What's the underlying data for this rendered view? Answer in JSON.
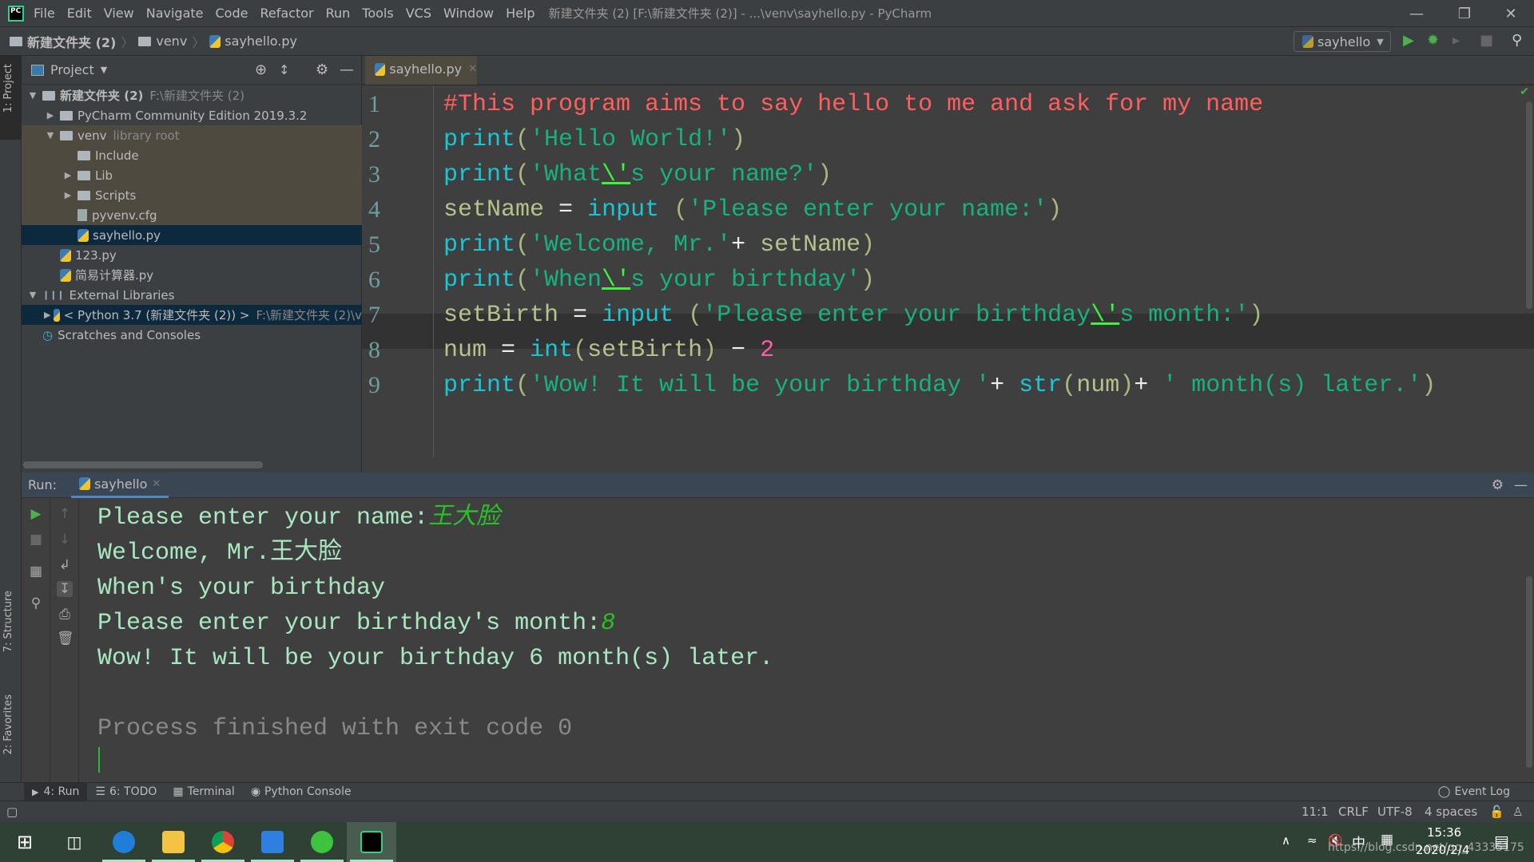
{
  "window": {
    "title": "新建文件夹 (2) [F:\\新建文件夹 (2)] - ...\\venv\\sayhello.py - PyCharm",
    "menu": [
      "File",
      "Edit",
      "View",
      "Navigate",
      "Code",
      "Refactor",
      "Run",
      "Tools",
      "VCS",
      "Window",
      "Help"
    ]
  },
  "breadcrumb": [
    "新建文件夹 (2)",
    "venv",
    "sayhello.py"
  ],
  "toolbar": {
    "run_config": "sayhello"
  },
  "side_tabs": {
    "project": "1: Project",
    "structure": "7: Structure",
    "favorites": "2: Favorites"
  },
  "project": {
    "title": "Project",
    "tree": [
      {
        "label": "新建文件夹 (2)",
        "hint": "F:\\新建文件夹 (2)",
        "icon": "folder-icon",
        "expanded": true,
        "level": 0
      },
      {
        "label": "PyCharm Community Edition 2019.3.2",
        "icon": "folder-icon",
        "expanded": false,
        "level": 1
      },
      {
        "label": "venv",
        "hint": "library root",
        "icon": "folder-icon",
        "expanded": true,
        "level": 1
      },
      {
        "label": "Include",
        "icon": "folder-icon",
        "level": 2
      },
      {
        "label": "Lib",
        "icon": "folder-icon",
        "expanded": false,
        "level": 2
      },
      {
        "label": "Scripts",
        "icon": "folder-icon",
        "expanded": false,
        "level": 2
      },
      {
        "label": "pyvenv.cfg",
        "icon": "file-icon",
        "level": 2
      },
      {
        "label": "sayhello.py",
        "icon": "python-file-icon",
        "level": 2,
        "selected": true
      },
      {
        "label": "123.py",
        "icon": "python-file-icon",
        "level": 1
      },
      {
        "label": "简易计算器.py",
        "icon": "python-file-icon",
        "level": 1
      },
      {
        "label": "External Libraries",
        "icon": "library-icon",
        "expanded": true,
        "level": 0
      },
      {
        "label": "< Python 3.7 (新建文件夹 (2)) >",
        "hint": "F:\\新建文件夹 (2)\\v",
        "icon": "python-icon",
        "expanded": false,
        "level": 1
      },
      {
        "label": "Scratches and Consoles",
        "icon": "scratches-icon",
        "level": 0
      }
    ]
  },
  "editor": {
    "tab": "sayhello.py",
    "current_line": 8,
    "lines": [
      "#This program aims to say hello to me and ask for my name",
      "print('Hello World!')",
      "print('What\\'s your name?')",
      "setName = input ('Please enter your name:')",
      "print('Welcome, Mr.'+ setName)",
      "print('When\\'s your birthday')",
      "setBirth = input ('Please enter your birthday\\'s month:')",
      "num = int(setBirth) - 2",
      "print('Wow! It will be your birthday '+ str(num)+ ' month(s) later.')"
    ]
  },
  "run": {
    "label": "Run:",
    "tab": "sayhello",
    "output": [
      {
        "text": "Please enter your name:",
        "input": "王大脸"
      },
      {
        "text": "Welcome, Mr.王大脸"
      },
      {
        "text": "When's your birthday"
      },
      {
        "text": "Please enter your birthday's month:",
        "input": "8"
      },
      {
        "text": "Wow! It will be your birthday 6 month(s) later."
      },
      {
        "text": ""
      },
      {
        "text": "Process finished with exit code 0"
      }
    ]
  },
  "bottom_tabs": [
    "4: Run",
    "6: TODO",
    "Terminal",
    "Python Console"
  ],
  "event_log": "Event Log",
  "status": {
    "position": "11:1",
    "line_sep": "CRLF",
    "encoding": "UTF-8",
    "indent": "4 spaces"
  },
  "taskbar": {
    "time": "15:36",
    "date": "2020/2/4",
    "ime": "中",
    "watermark": "https://blog.csdn.net/qq_43335175"
  },
  "colors": {
    "comment": "#ff5f5f",
    "builtin": "#19c6d4",
    "string": "#17b280",
    "number": "#ff5fa8",
    "console_text": "#a8e8c0",
    "console_input": "#27c227",
    "selection": "#0d293e"
  }
}
